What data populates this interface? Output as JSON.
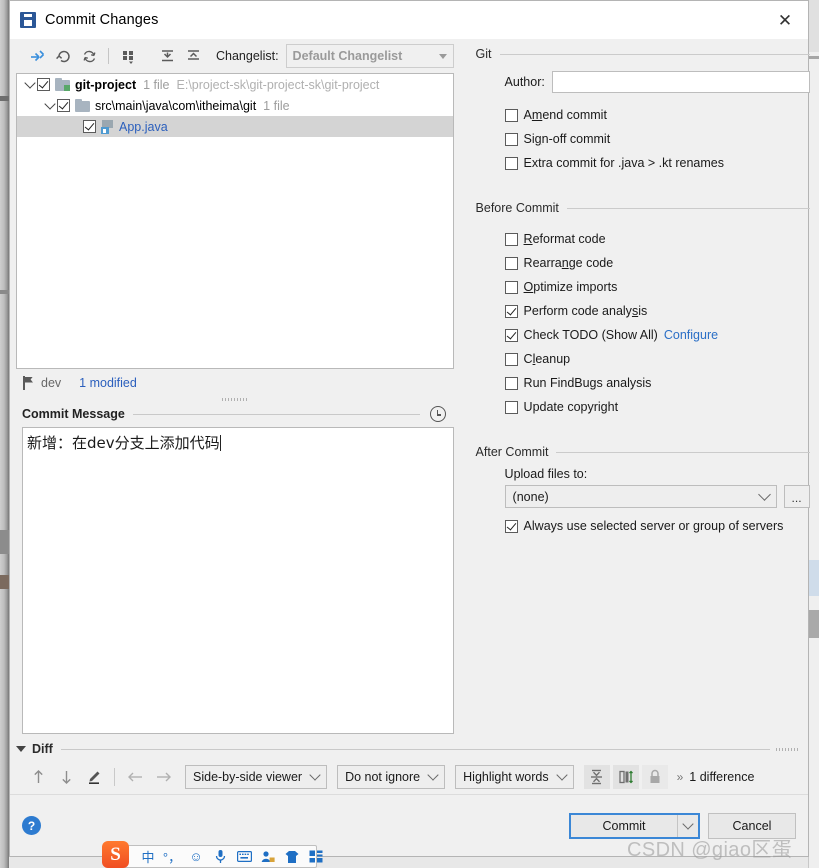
{
  "window": {
    "title": "Commit Changes",
    "app_icon": "intellij-idea-icon",
    "close_label": "✕"
  },
  "toolbar": {
    "buttons": [
      {
        "name": "show-diff-icon",
        "tooltip": "Show Diff"
      },
      {
        "name": "revert-icon",
        "tooltip": "Revert"
      },
      {
        "name": "refresh-icon",
        "tooltip": "Refresh Changes"
      },
      {
        "name": "group-by-icon",
        "tooltip": "Group By"
      },
      {
        "name": "expand-all-icon",
        "tooltip": "Expand All"
      },
      {
        "name": "collapse-all-icon",
        "tooltip": "Collapse All"
      }
    ],
    "changelist_label": "Changelist:",
    "changelist_value": "Default Changelist"
  },
  "tree": {
    "rows": [
      {
        "id": "root",
        "indent": 0,
        "expanded": true,
        "checked": true,
        "icon": "folder-vcs-icon",
        "name": "git-project",
        "meta": "1 file",
        "path": "E:\\project-sk\\git-project-sk\\git-project",
        "selected": false,
        "blue": false
      },
      {
        "id": "pkg",
        "indent": 1,
        "expanded": true,
        "checked": true,
        "icon": "folder-icon",
        "name": "src\\main\\java\\com\\itheima\\git",
        "meta": "1 file",
        "path": "",
        "selected": false,
        "blue": false
      },
      {
        "id": "file",
        "indent": 2,
        "expanded": null,
        "checked": true,
        "icon": "java-file-icon",
        "name": "App.java",
        "meta": "",
        "path": "",
        "selected": true,
        "blue": true
      }
    ]
  },
  "branch_bar": {
    "icon": "branch-icon",
    "branch": "dev",
    "modified": "1 modified"
  },
  "commit_message": {
    "label": "Commit Message",
    "history_icon": "clock-icon",
    "value": "新增：在dev分支上添加代码"
  },
  "git_group": {
    "title": "Git",
    "author_label": "Author:",
    "author_value": "",
    "checkboxes": [
      {
        "label": "Amend commit",
        "checked": false,
        "mnemonic": "m"
      },
      {
        "label": "Sign-off commit",
        "checked": false,
        "mnemonic": "g"
      },
      {
        "label": "Extra commit for .java > .kt renames",
        "checked": false,
        "mnemonic": ""
      }
    ]
  },
  "before_commit_group": {
    "title": "Before Commit",
    "checkboxes": [
      {
        "label": "Reformat code",
        "checked": false,
        "mnemonic": "R",
        "link": ""
      },
      {
        "label": "Rearrange code",
        "checked": false,
        "mnemonic": "n",
        "link": ""
      },
      {
        "label": "Optimize imports",
        "checked": false,
        "mnemonic": "O",
        "link": ""
      },
      {
        "label": "Perform code analysis",
        "checked": true,
        "mnemonic": "s",
        "link": ""
      },
      {
        "label": "Check TODO (Show All)",
        "checked": true,
        "mnemonic": "",
        "link": "Configure"
      },
      {
        "label": "Cleanup",
        "checked": false,
        "mnemonic": "l",
        "link": ""
      },
      {
        "label": "Run FindBugs analysis",
        "checked": false,
        "mnemonic": "",
        "link": ""
      },
      {
        "label": "Update copyright",
        "checked": false,
        "mnemonic": "",
        "link": ""
      }
    ]
  },
  "after_commit_group": {
    "title": "After Commit",
    "upload_label": "Upload files to:",
    "upload_value": "(none)",
    "browse_label": "...",
    "always_use_label": "Always use selected server or group of servers",
    "always_use_checked": true
  },
  "diff_section": {
    "title": "Diff",
    "toolbar_icons": [
      {
        "name": "previous-difference-icon"
      },
      {
        "name": "next-difference-icon"
      },
      {
        "name": "edit-source-icon"
      },
      {
        "name": "arrow-left-icon"
      },
      {
        "name": "arrow-right-icon"
      }
    ],
    "viewer_mode": "Side-by-side viewer",
    "ignore_mode": "Do not ignore",
    "highlight_mode": "Highlight words",
    "toggle_icons": [
      {
        "name": "collapse-unchanged-icon",
        "active": true
      },
      {
        "name": "synchronize-scrolling-icon",
        "active": true
      },
      {
        "name": "lock-icon",
        "active": false
      }
    ],
    "expand_chevron": "»",
    "difference_count": "1 difference"
  },
  "footer": {
    "help_label": "?",
    "commit_label": "Commit",
    "cancel_label": "Cancel"
  },
  "watermark": "CSDN @giao区蛋",
  "ime_bar": {
    "logo": "S",
    "items": [
      {
        "name": "chinese-mode-icon",
        "glyph": "中"
      },
      {
        "name": "punctuation-mode-icon",
        "glyph": "°，"
      },
      {
        "name": "emoji-icon",
        "glyph": "☺"
      },
      {
        "name": "voice-input-icon",
        "glyph": "ᵱ"
      },
      {
        "name": "soft-keyboard-icon",
        "glyph": "⌨"
      },
      {
        "name": "user-icon",
        "glyph": "☻"
      },
      {
        "name": "skin-icon",
        "glyph": "☃"
      },
      {
        "name": "toolbox-icon",
        "glyph": "▦"
      }
    ]
  },
  "colors": {
    "accent": "#3b87d6",
    "link": "#2b6fc6",
    "modified_file": "#2b5fbd",
    "dialog_bg": "#f0f0f0",
    "field_bg": "#ffffff"
  }
}
